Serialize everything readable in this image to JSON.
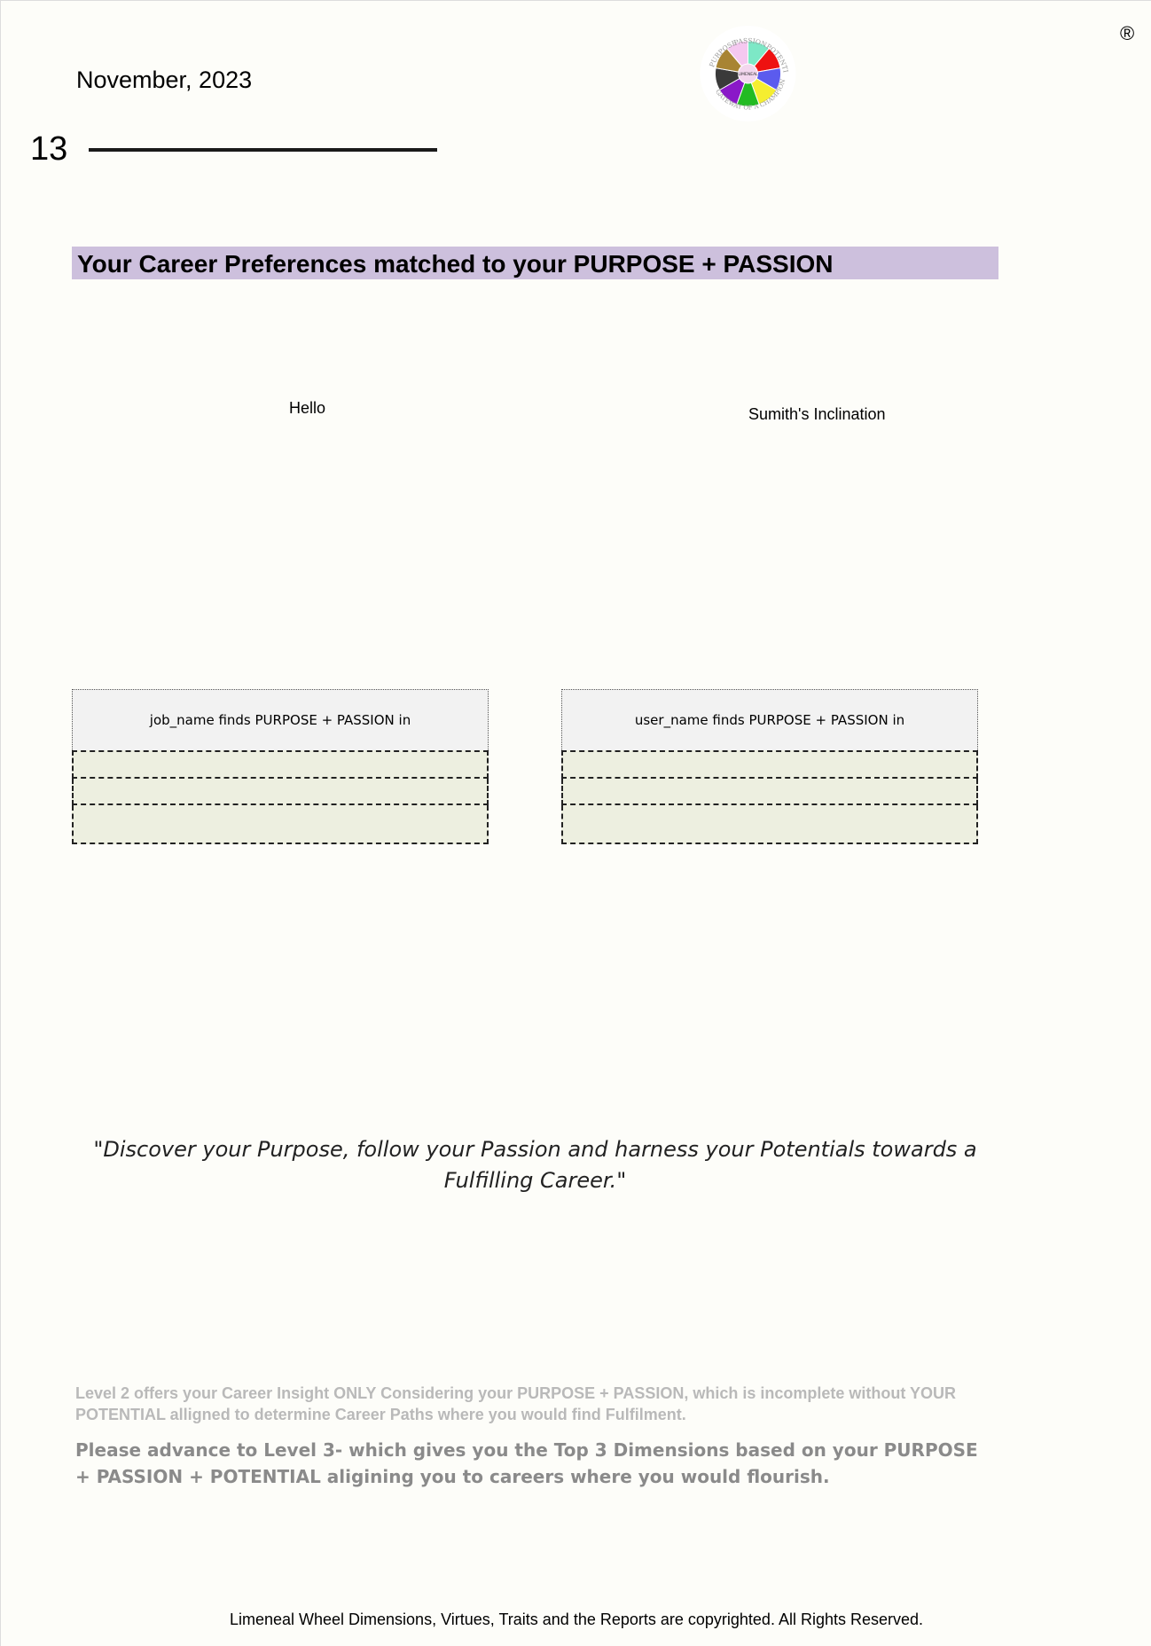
{
  "header": {
    "date": "November, 2023",
    "page_number": "13",
    "registered_mark": "®"
  },
  "logo": {
    "arc_top": "PASSION",
    "arc_left": "PURPOSE",
    "arc_right": "POTENTIAL",
    "arc_bottom": "GATEWAY OF A CHAMPION",
    "center": "LIMENEAL",
    "segment_colors": [
      "#7de8c6",
      "#ee1111",
      "#5b5bee",
      "#f5ee30",
      "#22bb22",
      "#8a18c8",
      "#3a3a3a",
      "#a88433",
      "#f5c8f0"
    ]
  },
  "section": {
    "title": "Your Career Preferences matched to your PURPOSE + PASSION"
  },
  "charts": {
    "left_label": "Hello",
    "right_label": "Sumith's Inclination"
  },
  "tables": {
    "left_header": "job_name finds PURPOSE + PASSION in",
    "right_header": "user_name finds PURPOSE + PASSION in"
  },
  "quote": "\"Discover your Purpose, follow your Passion and harness your Potentials towards a Fulfilling Career.\"",
  "notes": {
    "level2": "Level 2 offers your Career Insight ONLY Considering your PURPOSE + PASSION, which is incomplete without YOUR POTENTIAL alligned to determine Career Paths where you would find Fulfilment.",
    "level3": "Please advance to Level 3- which gives you the Top 3 Dimensions based on your PURPOSE + PASSION + POTENTIAL aligining you to careers where you would flourish."
  },
  "footer": "Limeneal Wheel Dimensions, Virtues, Traits and the Reports are copyrighted. All Rights Reserved."
}
